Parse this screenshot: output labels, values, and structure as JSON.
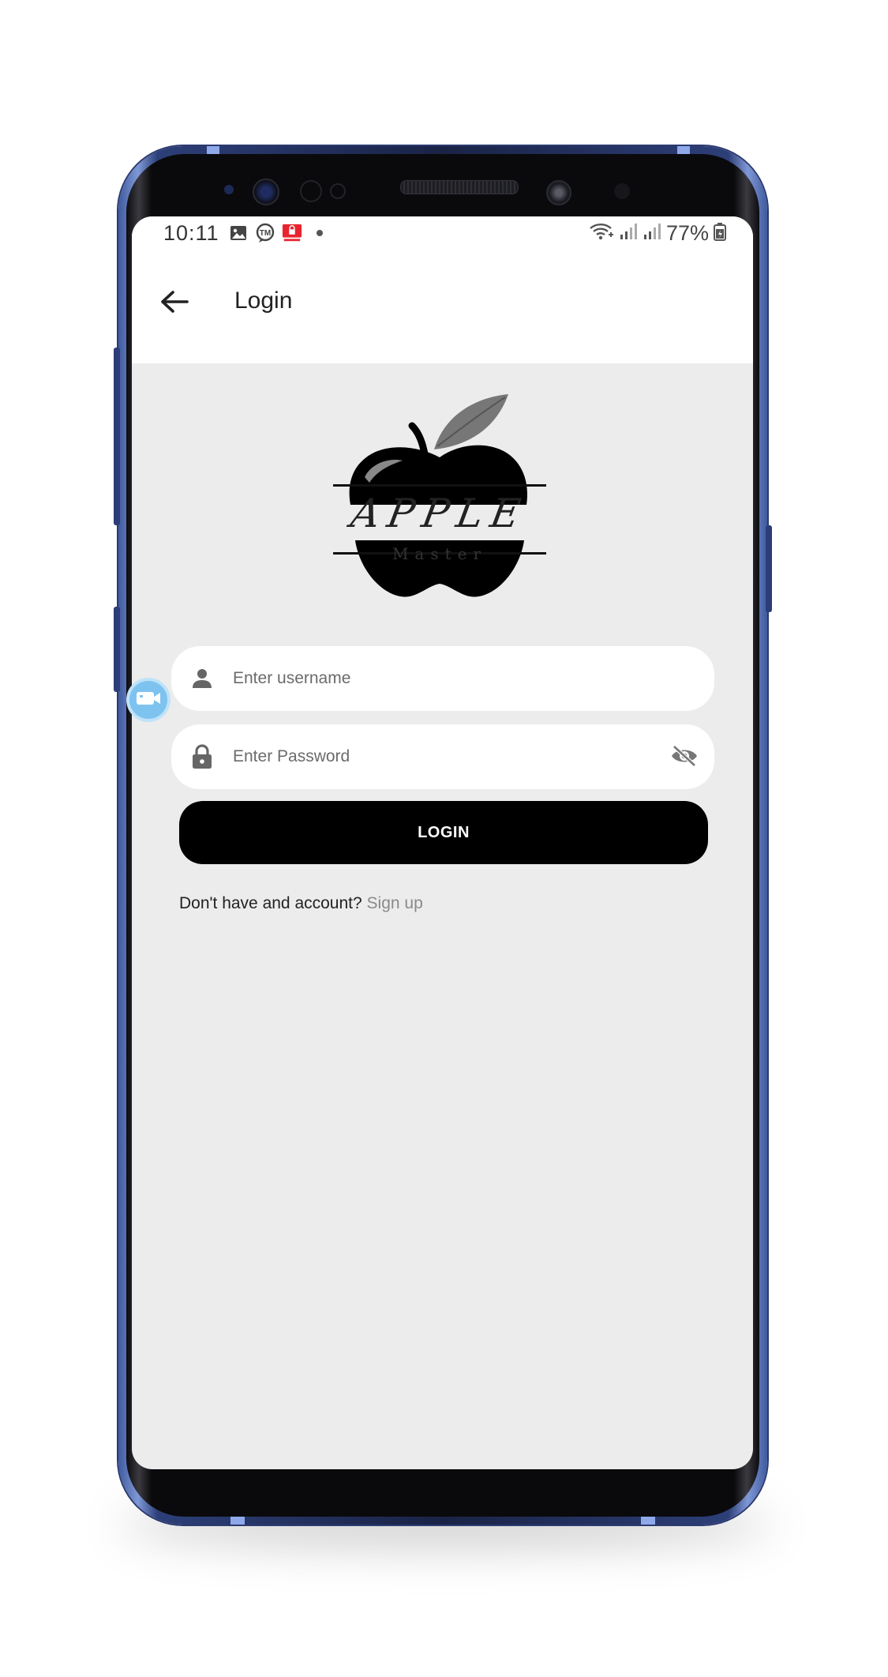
{
  "status_bar": {
    "time": "10:11",
    "battery": "77%",
    "left_icons": [
      "image-icon",
      "tm-icon",
      "lock-notification-icon",
      "dot-icon"
    ],
    "right_icons": [
      "wifi-icon",
      "signal-icon",
      "signal-icon-2",
      "battery-icon"
    ]
  },
  "app_bar": {
    "title": "Login",
    "back_icon": "arrow-left-icon"
  },
  "logo": {
    "title": "APPLE",
    "subtitle": "Master"
  },
  "form": {
    "username_placeholder": "Enter username",
    "password_placeholder": "Enter Password",
    "username_icon": "person-icon",
    "password_icon": "lock-icon",
    "visibility_icon": "eye-off-icon",
    "login_label": "LOGIN"
  },
  "signup": {
    "prompt": "Don't have and account?",
    "link": "Sign up"
  },
  "colors": {
    "screen_bg": "#ececec",
    "button_bg": "#000000",
    "link": "#8a8a8a",
    "frame": "#2d3f78"
  }
}
